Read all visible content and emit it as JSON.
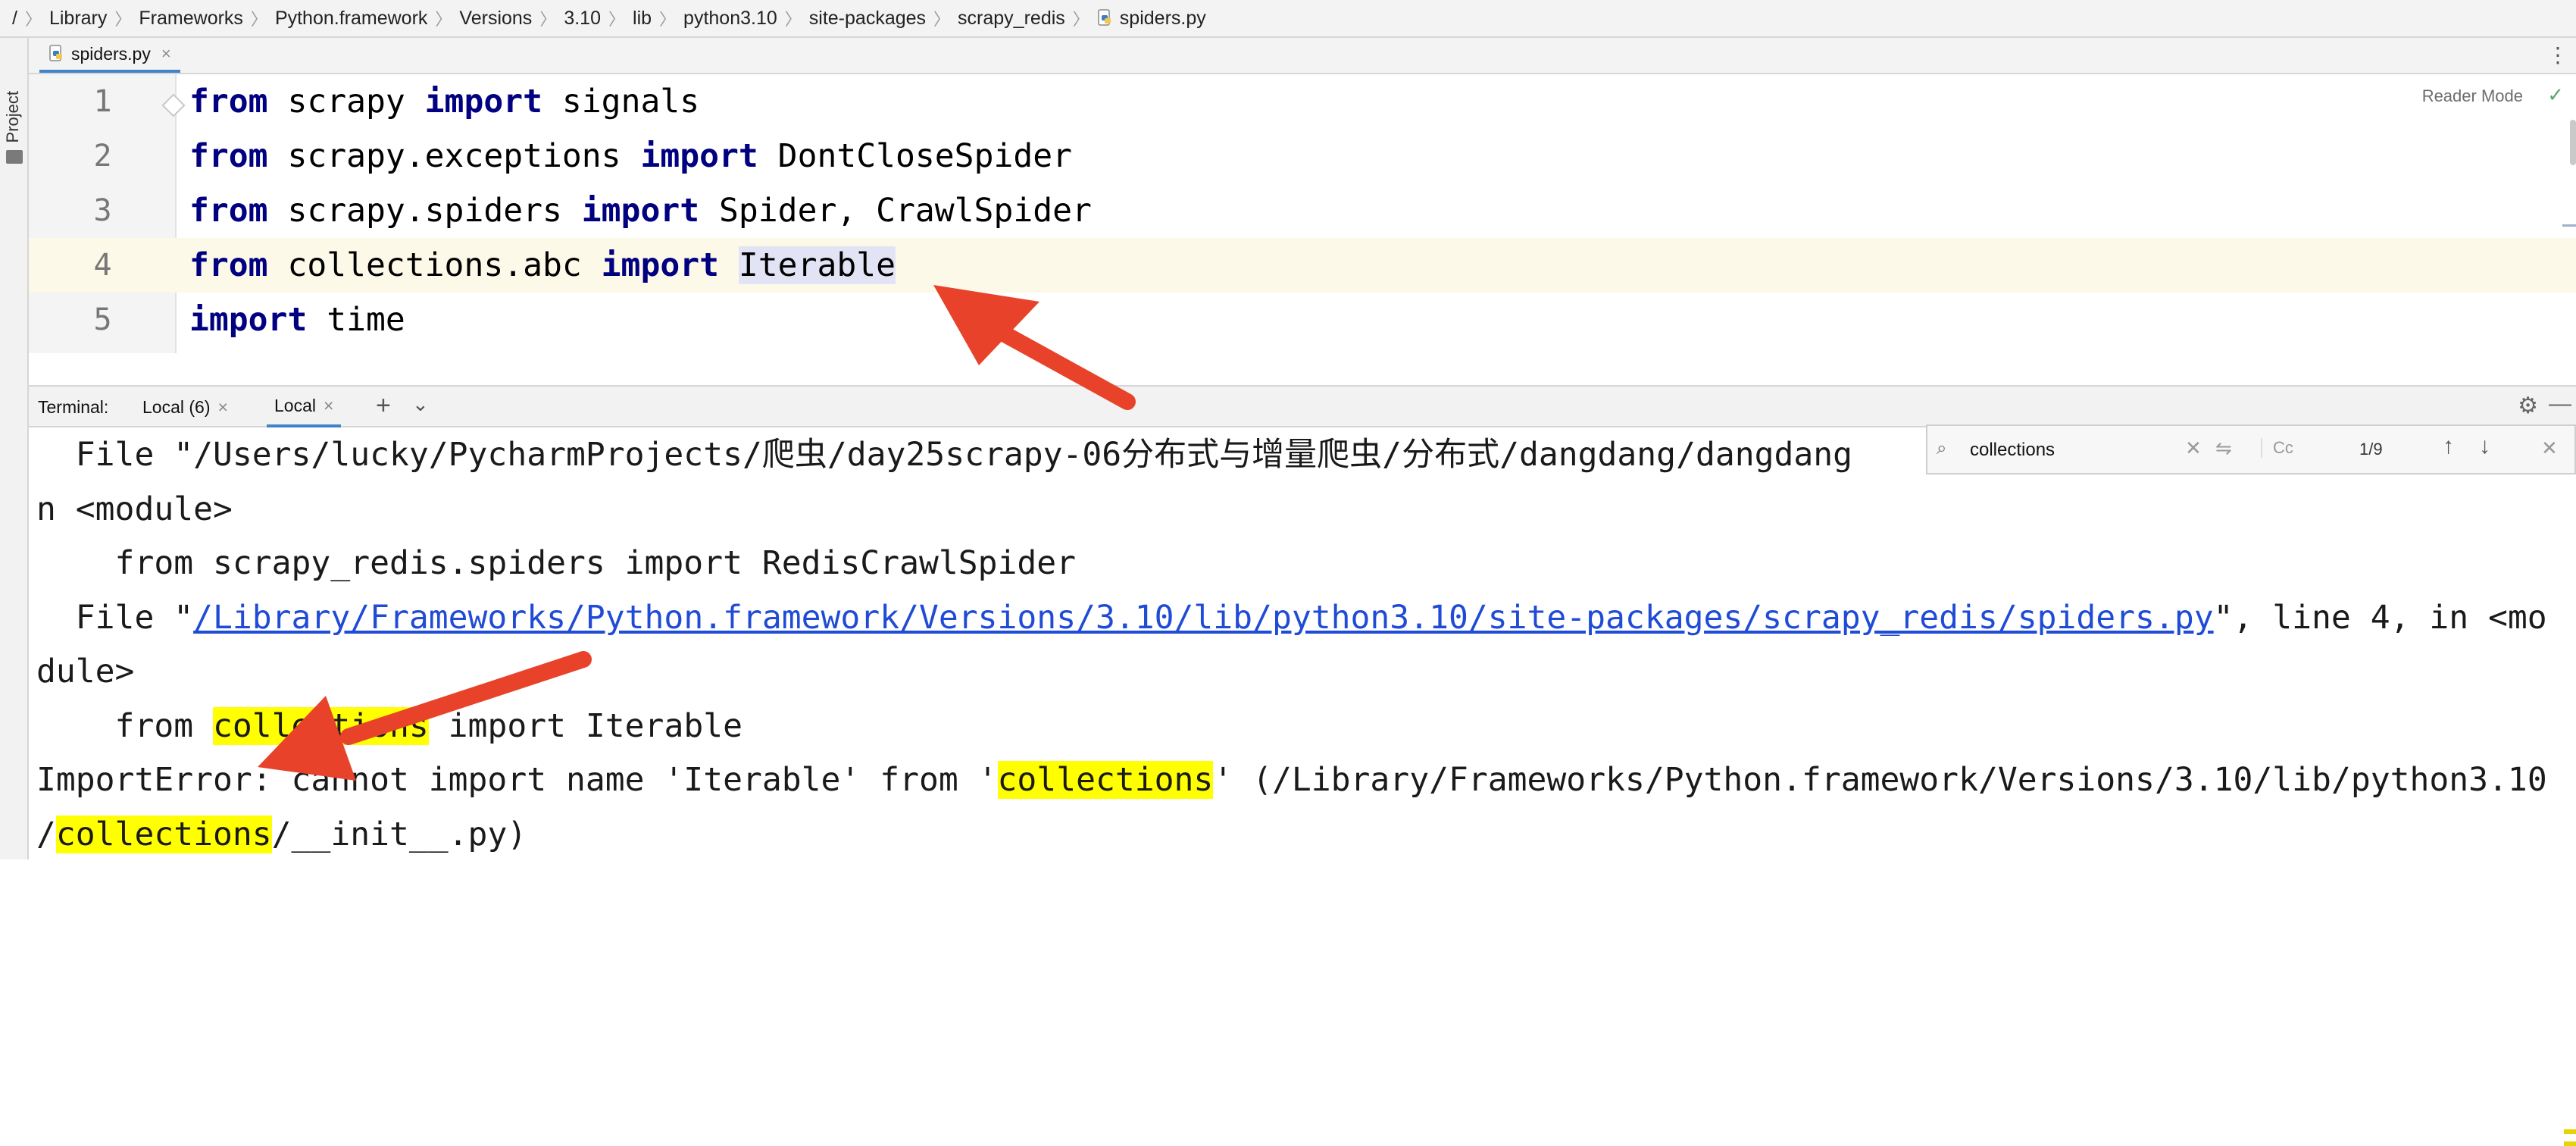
{
  "breadcrumb": {
    "root": "/",
    "items": [
      "Library",
      "Frameworks",
      "Python.framework",
      "Versions",
      "3.10",
      "lib",
      "python3.10",
      "site-packages",
      "scrapy_redis"
    ],
    "file": "spiders.py"
  },
  "left_strip": {
    "label": "Project"
  },
  "editor_tab": {
    "name": "spiders.py",
    "close": "×",
    "menu": "⋮"
  },
  "editor": {
    "reader_mode": "Reader Mode",
    "check": "✓",
    "lines": [
      {
        "num": "1",
        "parts": [
          {
            "t": "from",
            "kw": true
          },
          {
            "t": " scrapy "
          },
          {
            "t": "import",
            "kw": true
          },
          {
            "t": " signals"
          }
        ]
      },
      {
        "num": "2",
        "parts": [
          {
            "t": "from",
            "kw": true
          },
          {
            "t": " scrapy.exceptions "
          },
          {
            "t": "import",
            "kw": true
          },
          {
            "t": " DontCloseSpider"
          }
        ]
      },
      {
        "num": "3",
        "parts": [
          {
            "t": "from",
            "kw": true
          },
          {
            "t": " scrapy.spiders "
          },
          {
            "t": "import",
            "kw": true
          },
          {
            "t": " Spider, CrawlSpider"
          }
        ]
      },
      {
        "num": "4",
        "parts": [
          {
            "t": "from",
            "kw": true
          },
          {
            "t": " collections.abc "
          },
          {
            "t": "import",
            "kw": true
          },
          {
            "t": " "
          },
          {
            "t": "Iterable",
            "hl": true
          }
        ]
      },
      {
        "num": "5",
        "parts": [
          {
            "t": "import",
            "kw": true
          },
          {
            "t": " time"
          }
        ]
      }
    ]
  },
  "terminal": {
    "label": "Terminal:",
    "tabs": [
      {
        "name": "Local (6)",
        "close": "×"
      },
      {
        "name": "Local",
        "close": "×"
      }
    ],
    "add": "+",
    "dropdown": "⌄",
    "settings": "⚙",
    "minimize": "—",
    "lines": [
      [
        {
          "t": "  File \"/Users/lucky/PycharmProjects/爬虫/day25scrapy-06分布式与增量爬虫/分布式/dangdang/dangdang"
        }
      ],
      [
        {
          "t": "n <module>"
        }
      ],
      [
        {
          "t": "    from scrapy_redis.spiders import RedisCrawlSpider"
        }
      ],
      [
        {
          "t": "  File \""
        },
        {
          "t": "/Library/Frameworks/Python.framework/Versions/3.10/lib/python3.10/site-packages/scrapy_redis/spiders.py",
          "link": true
        },
        {
          "t": "\", line 4, in <mo"
        }
      ],
      [
        {
          "t": "dule>"
        }
      ],
      [
        {
          "t": "    from "
        },
        {
          "t": "collections",
          "match": true
        },
        {
          "t": " import Iterable"
        }
      ],
      [
        {
          "t": "ImportError: cannot import name 'Iterable' from '"
        },
        {
          "t": "collections",
          "match": true
        },
        {
          "t": "' (/Library/Frameworks/Python.framework/Versions/3.10/lib/python3.10"
        }
      ],
      [
        {
          "t": "/"
        },
        {
          "t": "collections",
          "match": true
        },
        {
          "t": "/__init__.py)"
        }
      ]
    ]
  },
  "search": {
    "query": "collections",
    "clear": "✕",
    "replace": "⇋",
    "case": "Cc",
    "count": "1/9",
    "up": "↑",
    "down": "↓",
    "close": "✕"
  },
  "colors": {
    "keyword": "#000080",
    "match": "#ffff00",
    "arrow": "#e8432a",
    "link": "#1f4bd6"
  }
}
